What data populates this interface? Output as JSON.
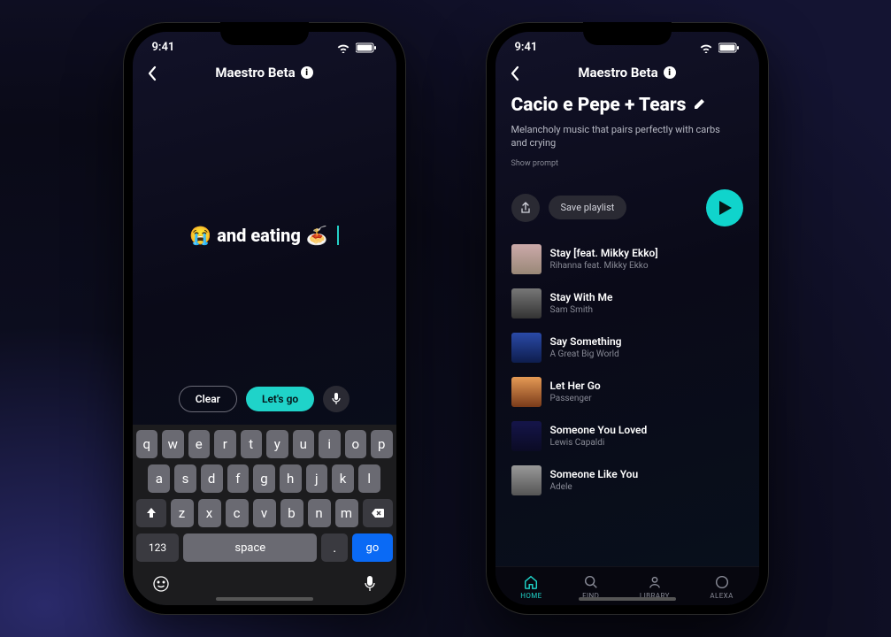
{
  "status_time": "9:41",
  "app_title": "Maestro Beta",
  "compose": {
    "emoji1": "😭",
    "text": "and eating",
    "emoji2": "🍝",
    "clear_label": "Clear",
    "go_label": "Let's go"
  },
  "keyboard": {
    "row1": [
      "q",
      "w",
      "e",
      "r",
      "t",
      "y",
      "u",
      "i",
      "o",
      "p"
    ],
    "row2": [
      "a",
      "s",
      "d",
      "f",
      "g",
      "h",
      "j",
      "k",
      "l"
    ],
    "row3": [
      "z",
      "x",
      "c",
      "v",
      "b",
      "n",
      "m"
    ],
    "num_label": "123",
    "space_label": "space",
    "dot_label": ".",
    "go_label": "go"
  },
  "playlist": {
    "title": "Cacio e Pepe + Tears",
    "description": "Melancholy music that pairs perfectly with carbs and crying",
    "show_prompt_label": "Show prompt",
    "save_label": "Save playlist",
    "tracks": [
      {
        "title": "Stay [feat. Mikky Ekko]",
        "artist": "Rihanna feat. Mikky Ekko"
      },
      {
        "title": "Stay With Me",
        "artist": "Sam Smith"
      },
      {
        "title": "Say Something",
        "artist": "A Great Big World"
      },
      {
        "title": "Let Her Go",
        "artist": "Passenger"
      },
      {
        "title": "Someone You Loved",
        "artist": "Lewis Capaldi"
      },
      {
        "title": "Someone Like You",
        "artist": "Adele"
      }
    ]
  },
  "tabs": {
    "home": "HOME",
    "find": "FIND",
    "library": "LIBRARY",
    "alexa": "ALEXA"
  }
}
